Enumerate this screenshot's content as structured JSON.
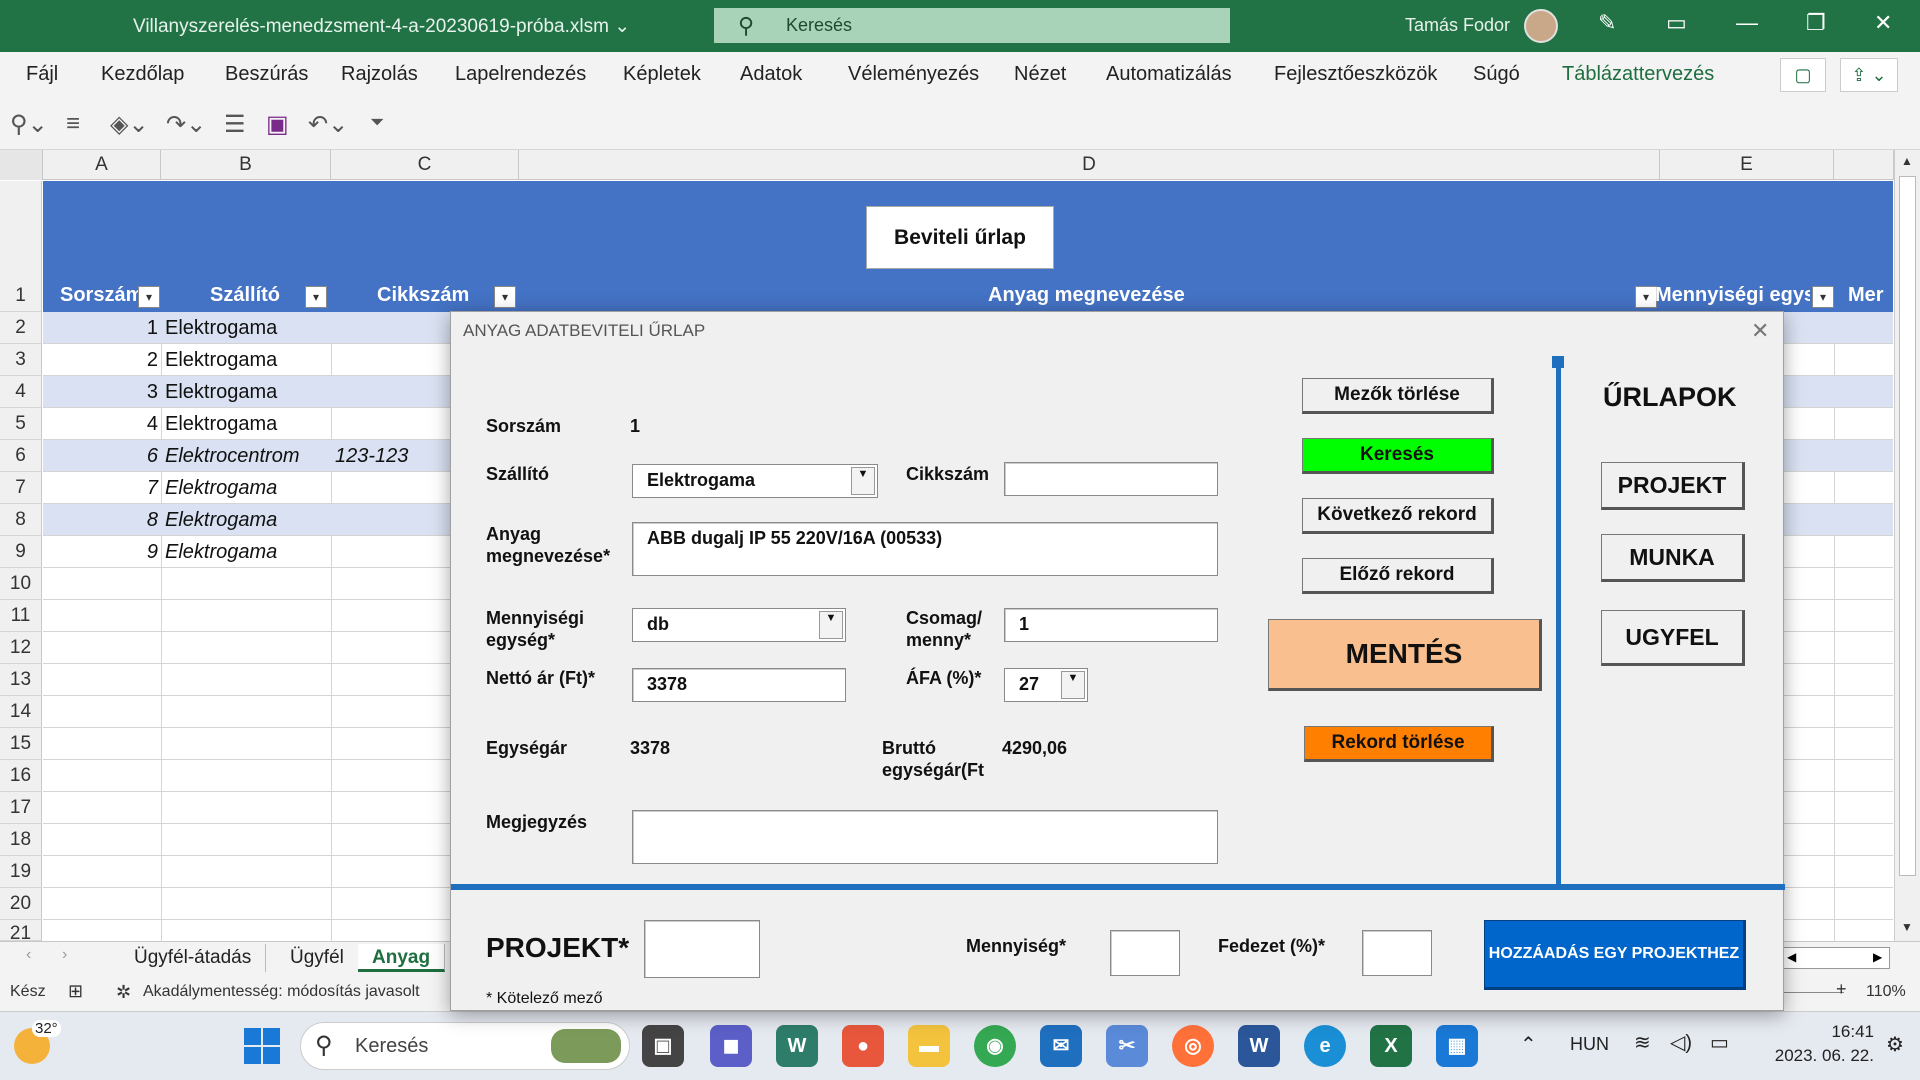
{
  "window": {
    "title": "Villanyszerelés-menedzsment-4-a-20230619-próba.xlsm",
    "search_placeholder": "Keresés",
    "user_name": "Tamás Fodor"
  },
  "menu": [
    "Fájl",
    "Kezdőlap",
    "Beszúrás",
    "Rajzolás",
    "Lapelrendezés",
    "Képletek",
    "Adatok",
    "Véleményezés",
    "Nézet",
    "Automatizálás",
    "Fejlesztőeszközök",
    "Súgó",
    "Táblázattervezés"
  ],
  "columns": [
    "A",
    "B",
    "C",
    "D",
    "E"
  ],
  "rows": [
    "1",
    "2",
    "3",
    "4",
    "5",
    "6",
    "7",
    "8",
    "9",
    "10",
    "11",
    "12",
    "13",
    "14",
    "15",
    "16",
    "17",
    "18",
    "19",
    "20",
    "21"
  ],
  "sheet": {
    "form_button": "Beviteli űrlap",
    "headers": {
      "sorszam": "Sorszám",
      "szallito": "Szállító",
      "cikkszam": "Cikkszám",
      "anyag": "Anyag megnevezése",
      "menny": "Mennyiségi egys",
      "mer": "Mer"
    },
    "filter_icon": "▾",
    "data": [
      {
        "n": "1",
        "s": "Elektrogama",
        "c": ""
      },
      {
        "n": "2",
        "s": "Elektrogama",
        "c": ""
      },
      {
        "n": "3",
        "s": "Elektrogama",
        "c": ""
      },
      {
        "n": "4",
        "s": "Elektrogama",
        "c": ""
      },
      {
        "n": "6",
        "s": "Elektrocentrom",
        "c": "123-123"
      },
      {
        "n": "7",
        "s": "Elektrogama",
        "c": ""
      },
      {
        "n": "8",
        "s": "Elektrogama",
        "c": ""
      },
      {
        "n": "9",
        "s": "Elektrogama",
        "c": ""
      }
    ]
  },
  "tabs": [
    "Ügyfél-átadás",
    "Ügyfél",
    "Anyag"
  ],
  "status": {
    "ready": "Kész",
    "accessibility": "Akadálymentesség: módosítás javasolt",
    "zoom": "110%"
  },
  "dialog": {
    "caption": "ANYAG ADATBEVITELI ŰRLAP",
    "sorszam_label": "Sorszám",
    "sorszam_value": "1",
    "szallito_label": "Szállító",
    "szallito_value": "Elektrogama",
    "cikkszam_label": "Cikkszám",
    "cikkszam_value": "",
    "anyag_label_1": "Anyag",
    "anyag_label_2": "megnevezése*",
    "anyag_value": "ABB dugalj IP 55 220V/16A (00533)",
    "menny_label_1": "Mennyiségi",
    "menny_label_2": "egység*",
    "menny_value": "db",
    "csomag_label_1": "Csomag/",
    "csomag_label_2": "menny*",
    "csomag_value": "1",
    "netto_label": "Nettó ár (Ft)*",
    "netto_value": "3378",
    "afa_label": "ÁFA (%)*",
    "afa_value": "27",
    "egysegar_label": "Egységár",
    "egysegar_value": "3378",
    "brutto_label_1": "Bruttó",
    "brutto_label_2": "egységár(Ft",
    "brutto_value": "4290,06",
    "megjegyzes_label": "Megjegyzés",
    "megjegyzes_value": "",
    "btn_clear": "Mezők törlése",
    "btn_search": "Keresés",
    "btn_next": "Következő rekord",
    "btn_prev": "Előző rekord",
    "btn_save": "MENTÉS",
    "btn_delete": "Rekord törlése",
    "forms_title": "ŰRLAPOK",
    "btn_projekt": "PROJEKT",
    "btn_munka": "MUNKA",
    "btn_ugyfel": "UGYFEL",
    "projekt_label": "PROJEKT*",
    "mennyiseg_label": "Mennyiség*",
    "fedezet_label": "Fedezet (%)*",
    "btn_add": "HOZZÁADÁS EGY PROJEKTHEZ",
    "required_note": "* Kötelező mező"
  },
  "taskbar": {
    "weather": "32°",
    "search": "Keresés",
    "lang": "HUN",
    "time": "16:41",
    "date": "2023. 06. 22."
  },
  "colors": {
    "excel_green": "#217346",
    "table_blue": "#4472c4",
    "band": "#d9e1f2",
    "search_btn": "#00ff00",
    "save_btn": "#f9bf8f",
    "delete_btn": "#ff7f00",
    "add_btn": "#0066cc"
  }
}
